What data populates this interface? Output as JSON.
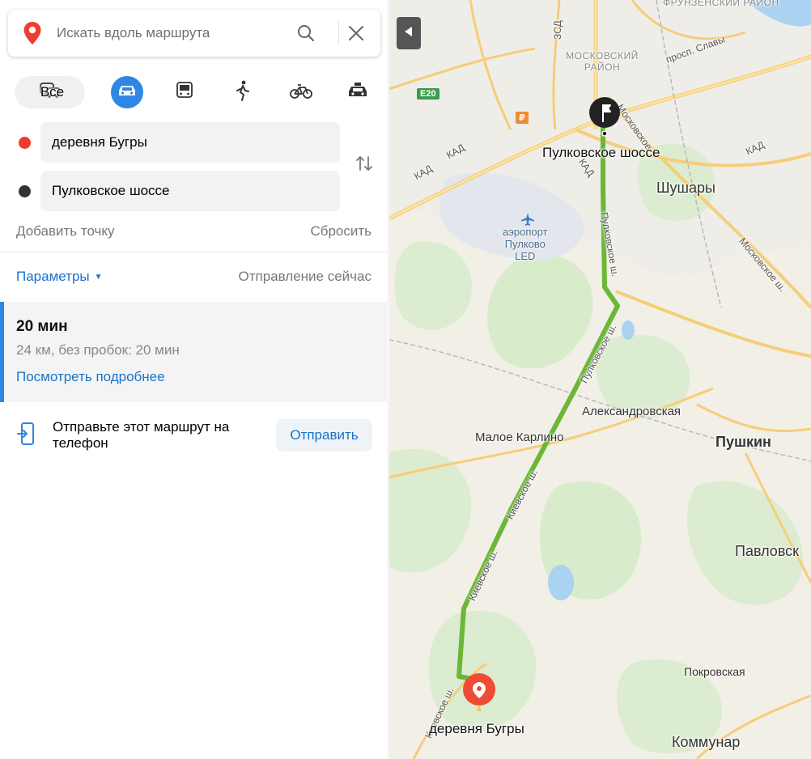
{
  "search": {
    "placeholder": "Искать вдоль маршрута"
  },
  "modes": {
    "all_label": "Все",
    "items": [
      "car-mode",
      "bus-mode",
      "walk-mode",
      "bike-mode",
      "taxi-mode"
    ],
    "selected": "car-mode"
  },
  "route_points": {
    "from": "деревня Бугры",
    "to": "Пулковское шоссе"
  },
  "actions": {
    "add_point": "Добавить точку",
    "reset": "Сбросить"
  },
  "params": {
    "label": "Параметры",
    "departure": "Отправление сейчас"
  },
  "route": {
    "time": "20 мин",
    "details": "24 км, без пробок: 20 мин",
    "more": "Посмотреть подробнее"
  },
  "share": {
    "text": "Отправьте этот маршрут на телефон",
    "button": "Отправить"
  },
  "map": {
    "districts": {
      "frunzensky": "ФРУНЗЕНСКИЙ РАЙОН",
      "moskovsky": "МОСКОВСКИЙ РАЙОН"
    },
    "places": {
      "shushary": "Шушары",
      "pushkin": "Пушкин",
      "pavlovsk": "Павловск",
      "kommunar": "Коммунар",
      "aleksandrovskaya": "Александровская",
      "maloe_karlino": "Малое Карлино",
      "pokrovskaya": "Покровская"
    },
    "airport": {
      "line1": "аэропорт",
      "line2": "Пулково",
      "line3": "LED"
    },
    "endpoints": {
      "start": "деревня Бугры",
      "finish": "Пулковское шоссе"
    },
    "roads": {
      "kad": "КАД",
      "zsd": "ЗСД",
      "e20": "E20",
      "slavy": "просп. Славы",
      "moskovskoe_sh": "Московское ш.",
      "moskovskoe_top": "Московское",
      "pulkovskoe_sh": "Пулковское ш.",
      "kievskoe_sh": "Киевское ш."
    },
    "route_color": "#6cb738",
    "start_marker_color": "#ef4b35"
  }
}
